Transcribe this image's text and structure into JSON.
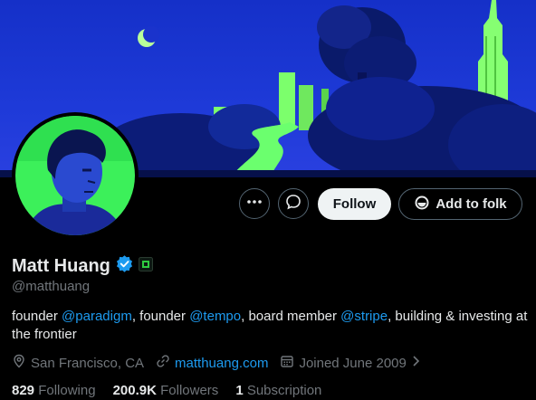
{
  "profile": {
    "name": "Matt Huang",
    "handle": "@matthuang",
    "verified_badge_color": "#1d9bf0"
  },
  "actions": {
    "more_icon": "more-dots-icon",
    "message_icon": "message-icon",
    "follow_label": "Follow",
    "folk_label": "Add to folk"
  },
  "bio": {
    "t1": "founder ",
    "m1": "@paradigm",
    "t2": ", founder ",
    "m2": "@tempo",
    "t3": ", board member ",
    "m3": "@stripe",
    "t4": ", building & investing at the frontier"
  },
  "meta": {
    "location": "San Francisco, CA",
    "website": "matthuang.com",
    "joined": "Joined June 2009"
  },
  "stats": {
    "following_count": "829",
    "following_label": "Following",
    "followers_count": "200.9K",
    "followers_label": "Followers",
    "subscription_count": "1",
    "subscription_label": "Subscription"
  },
  "colors": {
    "accent": "#1d9bf0",
    "banner_green": "#66ff66",
    "banner_blue": "#1a2aa0"
  }
}
